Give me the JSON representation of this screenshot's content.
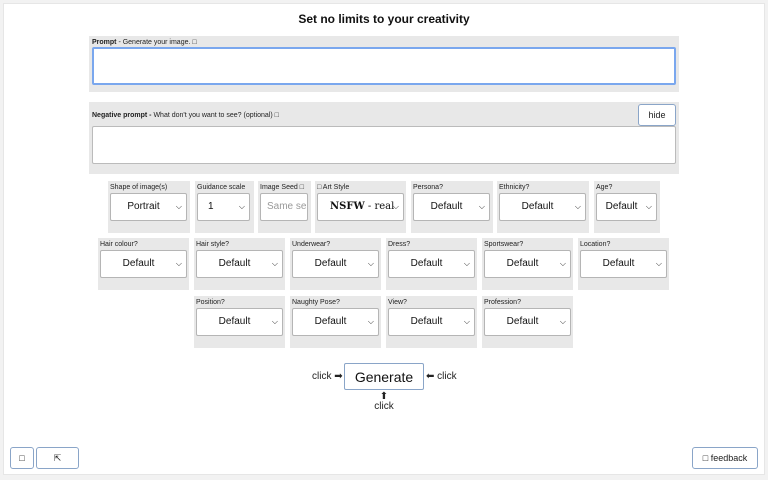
{
  "title": "Set no limits to your creativity",
  "prompt": {
    "label_bold": "Prompt",
    "label_rest": " - Generate your image. ",
    "info_icon": "□",
    "value": ""
  },
  "negative_prompt": {
    "label_bold": "Negative prompt - ",
    "label_rest": "What don't you want to see? (optional) ",
    "info_icon": "□",
    "value": "",
    "hide_label": "hide"
  },
  "options": {
    "shape": {
      "label": "Shape of image(s)",
      "value": "Portrait"
    },
    "guidance": {
      "label": "Guidance scale",
      "value": "1"
    },
    "seed": {
      "label": "Image Seed □",
      "placeholder": "Same se"
    },
    "art_style": {
      "label": "□ Art Style",
      "value_bold": "NSFW",
      "value_rest": " - real"
    },
    "persona": {
      "label": "Persona?",
      "value": "Default"
    },
    "ethnicity": {
      "label": "Ethnicity?",
      "value": "Default"
    },
    "age": {
      "label": "Age?",
      "value": "Default"
    },
    "hair_colour": {
      "label": "Hair colour?",
      "value": "Default"
    },
    "hair_style": {
      "label": "Hair style?",
      "value": "Default"
    },
    "underwear": {
      "label": "Underwear?",
      "value": "Default"
    },
    "dress": {
      "label": "Dress?",
      "value": "Default"
    },
    "sportswear": {
      "label": "Sportswear?",
      "value": "Default"
    },
    "location": {
      "label": "Location?",
      "value": "Default"
    },
    "position": {
      "label": "Position?",
      "value": "Default"
    },
    "naughty_pose": {
      "label": "Naughty Pose?",
      "value": "Default"
    },
    "view": {
      "label": "View?",
      "value": "Default"
    },
    "profession": {
      "label": "Profession?",
      "value": "Default"
    }
  },
  "chevron": "⌵",
  "generate": {
    "label": "Generate",
    "click_left": "click ➡",
    "click_right": "⬅ click",
    "click_below_arrow": "⬆",
    "click_below": "click"
  },
  "bottom": {
    "left_icon": "□",
    "top_icon": "⇱",
    "feedback_icon": "□",
    "feedback_label": " feedback"
  }
}
